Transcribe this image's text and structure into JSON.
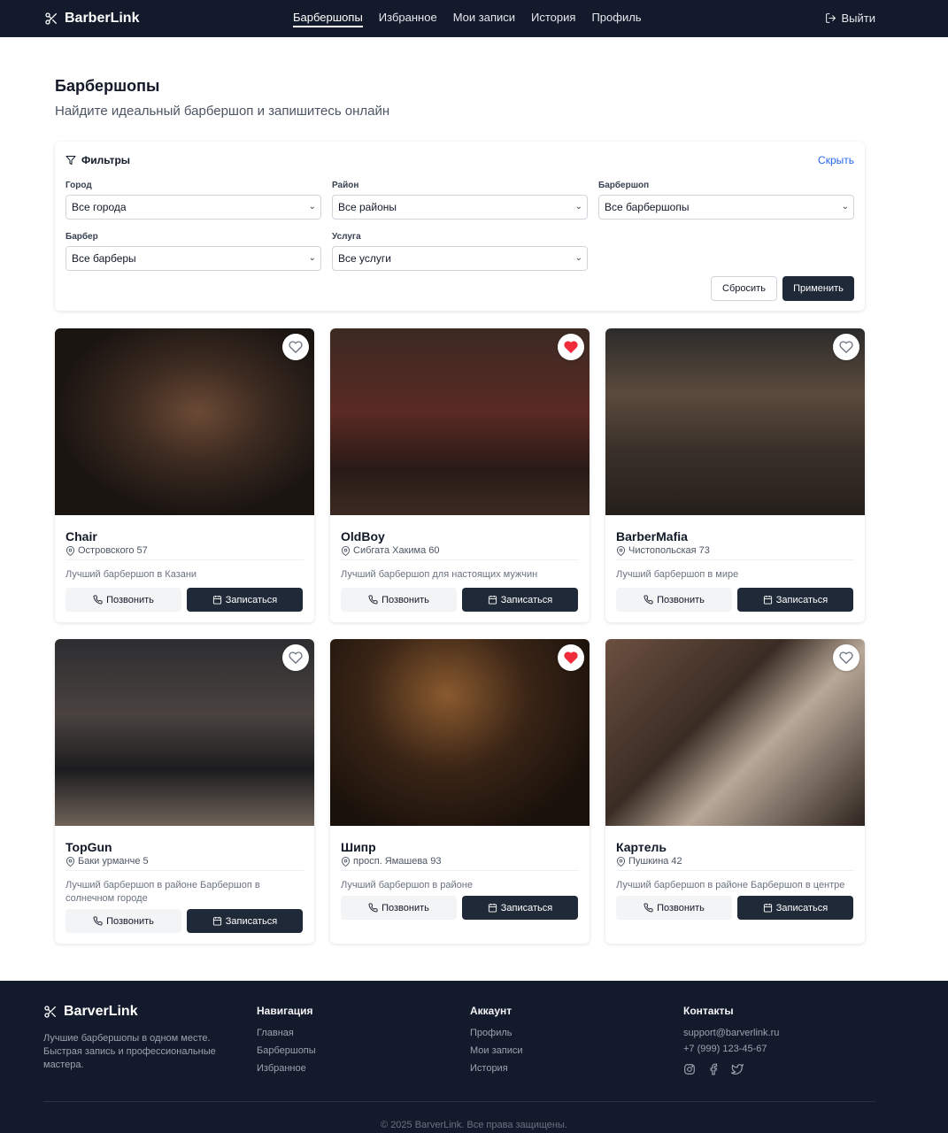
{
  "header": {
    "logo": "BarberLink",
    "nav": [
      "Барбершопы",
      "Избранное",
      "Мои записи",
      "История",
      "Профиль"
    ],
    "logout": "Выйти"
  },
  "page": {
    "title": "Барбершопы",
    "subtitle": "Найдите идеальный барбершоп и запишитесь онлайн"
  },
  "filters": {
    "title": "Фильтры",
    "hide": "Скрыть",
    "fields": [
      {
        "label": "Город",
        "value": "Все города"
      },
      {
        "label": "Район",
        "value": "Все районы"
      },
      {
        "label": "Барбершоп",
        "value": "Все барбершопы"
      },
      {
        "label": "Барбер",
        "value": "Все барберы"
      },
      {
        "label": "Услуга",
        "value": "Все услуги"
      }
    ],
    "reset": "Сбросить",
    "apply": "Применить"
  },
  "cards": [
    {
      "name": "Chair",
      "address": "Островского 57",
      "description": "Лучший барбершоп в Казани",
      "favorite": false
    },
    {
      "name": "OldBoy",
      "address": "Сибгата Хакима 60",
      "description": "Лучший барбершоп для настоящих мужчин",
      "favorite": true
    },
    {
      "name": "BarberMafia",
      "address": "Чистопольская 73",
      "description": "Лучший барбершоп в мире",
      "favorite": false
    },
    {
      "name": "TopGun",
      "address": "Баки урманче 5",
      "description": "Лучший барбершоп в районе Барбершоп в солнечном городе",
      "favorite": false
    },
    {
      "name": "Шипр",
      "address": "просп. Ямашева 93",
      "description": "Лучший барбершоп в районе",
      "favorite": true
    },
    {
      "name": "Картель",
      "address": "Пушкина 42",
      "description": "Лучший барбершоп в районе Барбершоп в центре",
      "favorite": false
    }
  ],
  "card_buttons": {
    "call": "Позвонить",
    "book": "Записаться"
  },
  "footer": {
    "logo": "BarverLink",
    "about": "Лучшие барбершопы в одном месте. Быстрая запись и профессиональные мастера.",
    "nav_title": "Навигация",
    "nav": [
      "Главная",
      "Барбершопы",
      "Избранное"
    ],
    "account_title": "Аккаунт",
    "account": [
      "Профиль",
      "Мои записи",
      "История"
    ],
    "contacts_title": "Контакты",
    "email": "support@barverlink.ru",
    "phone": "+7 (999) 123-45-67",
    "socials": [
      "instagram-icon",
      "facebook-icon",
      "twitter-icon"
    ],
    "copyright": "© 2025 BarverLink. Все права защищены."
  },
  "colors": {
    "header_bg": "#131a2b",
    "primary_button": "#1f2937",
    "link": "#2563eb",
    "favorite": "#ef2b3c"
  }
}
